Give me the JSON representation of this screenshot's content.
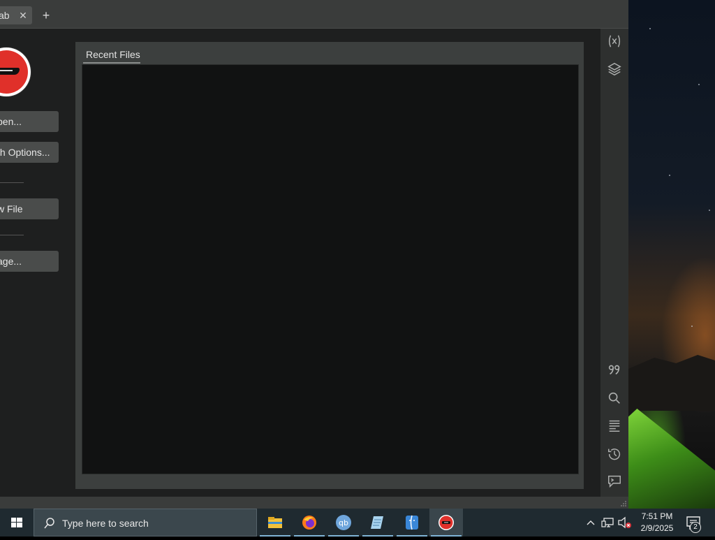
{
  "titlebar": {
    "text": "",
    "tab_label": "ab",
    "close_glyph": "✕",
    "new_tab_glyph": "+"
  },
  "sidebar": {
    "buttons": [
      {
        "label": "pen..."
      },
      {
        "label": "th Options..."
      },
      {
        "label": "w File"
      },
      {
        "label": "age..."
      }
    ]
  },
  "panel": {
    "title": "Recent Files"
  },
  "right_rail": {
    "icons": [
      "variables-icon",
      "layers-icon",
      "quote-icon",
      "search-icon",
      "text-lines-icon",
      "history-icon",
      "terminal-comment-icon"
    ]
  },
  "taskbar": {
    "search_placeholder": "Type here to search",
    "clock_time": "7:51 PM",
    "clock_date": "2/9/2025",
    "notification_count": "2",
    "apps": [
      "file-explorer-icon",
      "firefox-icon",
      "qbittorrent-icon",
      "notepad-icon",
      "finder-icon",
      "app-logo-icon"
    ]
  },
  "colors": {
    "accent": "#7fb3d5",
    "logo_red": "#e0302a"
  }
}
